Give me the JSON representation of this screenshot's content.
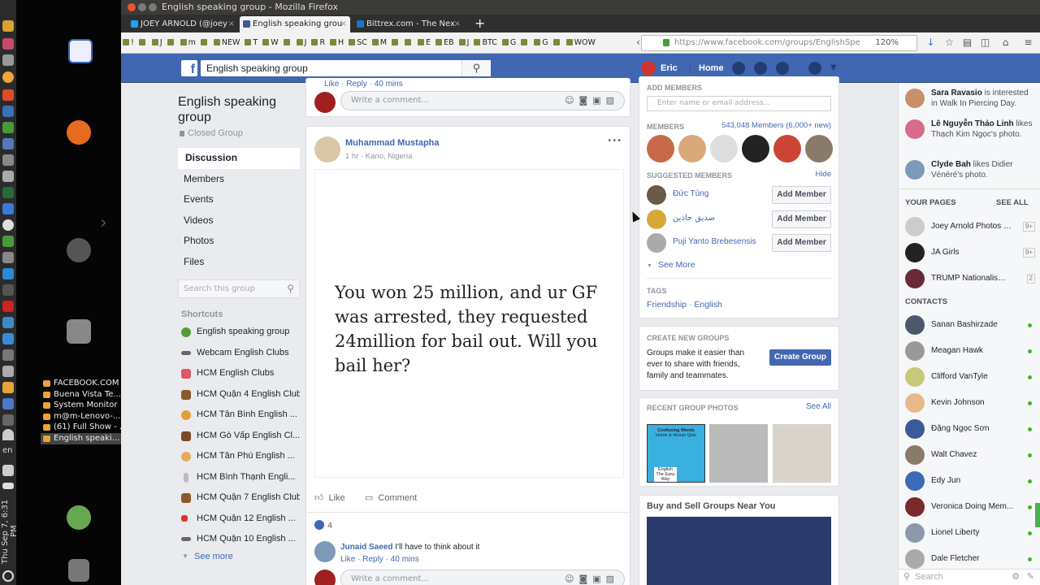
{
  "taskmenu": [
    "FACEBOOK.COM",
    "Buena Vista Te...",
    "System Monitor",
    "m@m-Lenovo-...",
    "(61) Full Show - ...",
    "English speaki..."
  ],
  "clock": "Thu Sep 7, 6:31 PM",
  "lang": "en",
  "window_title": "English speaking group - Mozilla Firefox",
  "tabs": [
    {
      "label": "JOEY ARNOLD (@joey"
    },
    {
      "label": "English speaking grou"
    },
    {
      "label": "Bittrex.com - The Nex"
    }
  ],
  "newtab": "+",
  "bookmarks": [
    "!",
    "",
    "J",
    "",
    "m",
    "",
    "NEW",
    "T",
    "W",
    "",
    "J",
    "R",
    "H",
    "SC",
    "M",
    "",
    "",
    "E",
    "EB",
    "J",
    "BTC",
    "G",
    "",
    "G",
    "",
    "WOW"
  ],
  "url": "https://www.facebook.com/groups/EnglishSpe",
  "zoom": "120%",
  "fb": {
    "search_value": "English speaking group",
    "user": "Eric",
    "home": "Home"
  },
  "group": {
    "name": "English speaking group",
    "privacy": "Closed Group",
    "nav": [
      "Discussion",
      "Members",
      "Events",
      "Videos",
      "Photos",
      "Files"
    ],
    "search_placeholder": "Search this group",
    "shortcuts_title": "Shortcuts",
    "shortcuts": [
      "English speaking group",
      "Webcam English Clubs",
      "HCM English Clubs",
      "HCM Quận 4 English Club",
      "HCM Tân Bình English ...",
      "HCM Gò Vấp English Cl...",
      "HCM Tân Phú English ...",
      "HCM Bình Thạnh Engli...",
      "HCM Quận 7 English Club",
      "HCM Quận 12 English ...",
      "HCM Quận 10 English ..."
    ],
    "see_more": "See more"
  },
  "feed": {
    "top_actions": "Like · Reply · 40 mins",
    "comment_placeholder": "Write a comment...",
    "post": {
      "author": "Muhammad Mustapha",
      "meta": "1 hr · Kano, Nigeria",
      "more": "•••",
      "image_text": "You won 25 million, and ur GF was  arrested, they requested 24million for bail out. Will you bail her?",
      "like": "Like",
      "comment": "Comment",
      "reactions": "4"
    },
    "reply": {
      "author": "Junaid Saeed",
      "text": "I'll have to think about it",
      "actions": "Like · Reply · 40 mins"
    }
  },
  "right": {
    "add_members_title": "ADD MEMBERS",
    "add_members_placeholder": "Enter name or email address...",
    "members_title": "MEMBERS",
    "members_count": "543,048 Members (6,000+ new)",
    "suggested_title": "SUGGESTED MEMBERS",
    "hide": "Hide",
    "suggested": [
      "Đức Tùng",
      "صديق جاذين",
      "Puji Yanto Brebesensis"
    ],
    "add_member": "Add Member",
    "see_more": "See More",
    "tags_title": "TAGS",
    "tags": "Friendship · English",
    "create_title": "CREATE NEW GROUPS",
    "create_text": "Groups make it easier than ever to share with friends, family and teammates.",
    "create_btn": "Create Group",
    "photos_title": "RECENT GROUP PHOTOS",
    "see_all": "See All",
    "photo1_title": "Confusing Words",
    "photo1_sub": "Home & House Quiz",
    "photo1_foot": "English The Easy Way",
    "buysell": "Buy and Sell Groups Near You"
  },
  "chat": {
    "ticker": [
      {
        "name": "Sara Ravasio",
        "text": " is interested in Walk In Piercing Day."
      },
      {
        "name": "Lê Nguyễn Thảo Linh",
        "text": " likes Thạch Kim Ngọc's photo."
      },
      {
        "name": "Clyde Bah",
        "text": " likes Didier Vénéré's photo."
      }
    ],
    "pages_title": "YOUR PAGES",
    "see_all": "SEE ALL",
    "pages": [
      {
        "name": "Joey Arnold Photos S...",
        "count": "9+"
      },
      {
        "name": "JA Girls",
        "count": "9+"
      },
      {
        "name": "TRUMP Nationalism O...",
        "count": "2"
      }
    ],
    "contacts_title": "CONTACTS",
    "contacts": [
      "Sanan Bashirzade",
      "Meagan Hawk",
      "Clifford VanTyle",
      "Kevin Johnson",
      "Đặng Ngọc Sơn",
      "Walt Chavez",
      "Edy Jun",
      "Veronica Doing Mem...",
      "Lionel Liberty",
      "Dale Fletcher"
    ],
    "search_placeholder": "Search"
  }
}
